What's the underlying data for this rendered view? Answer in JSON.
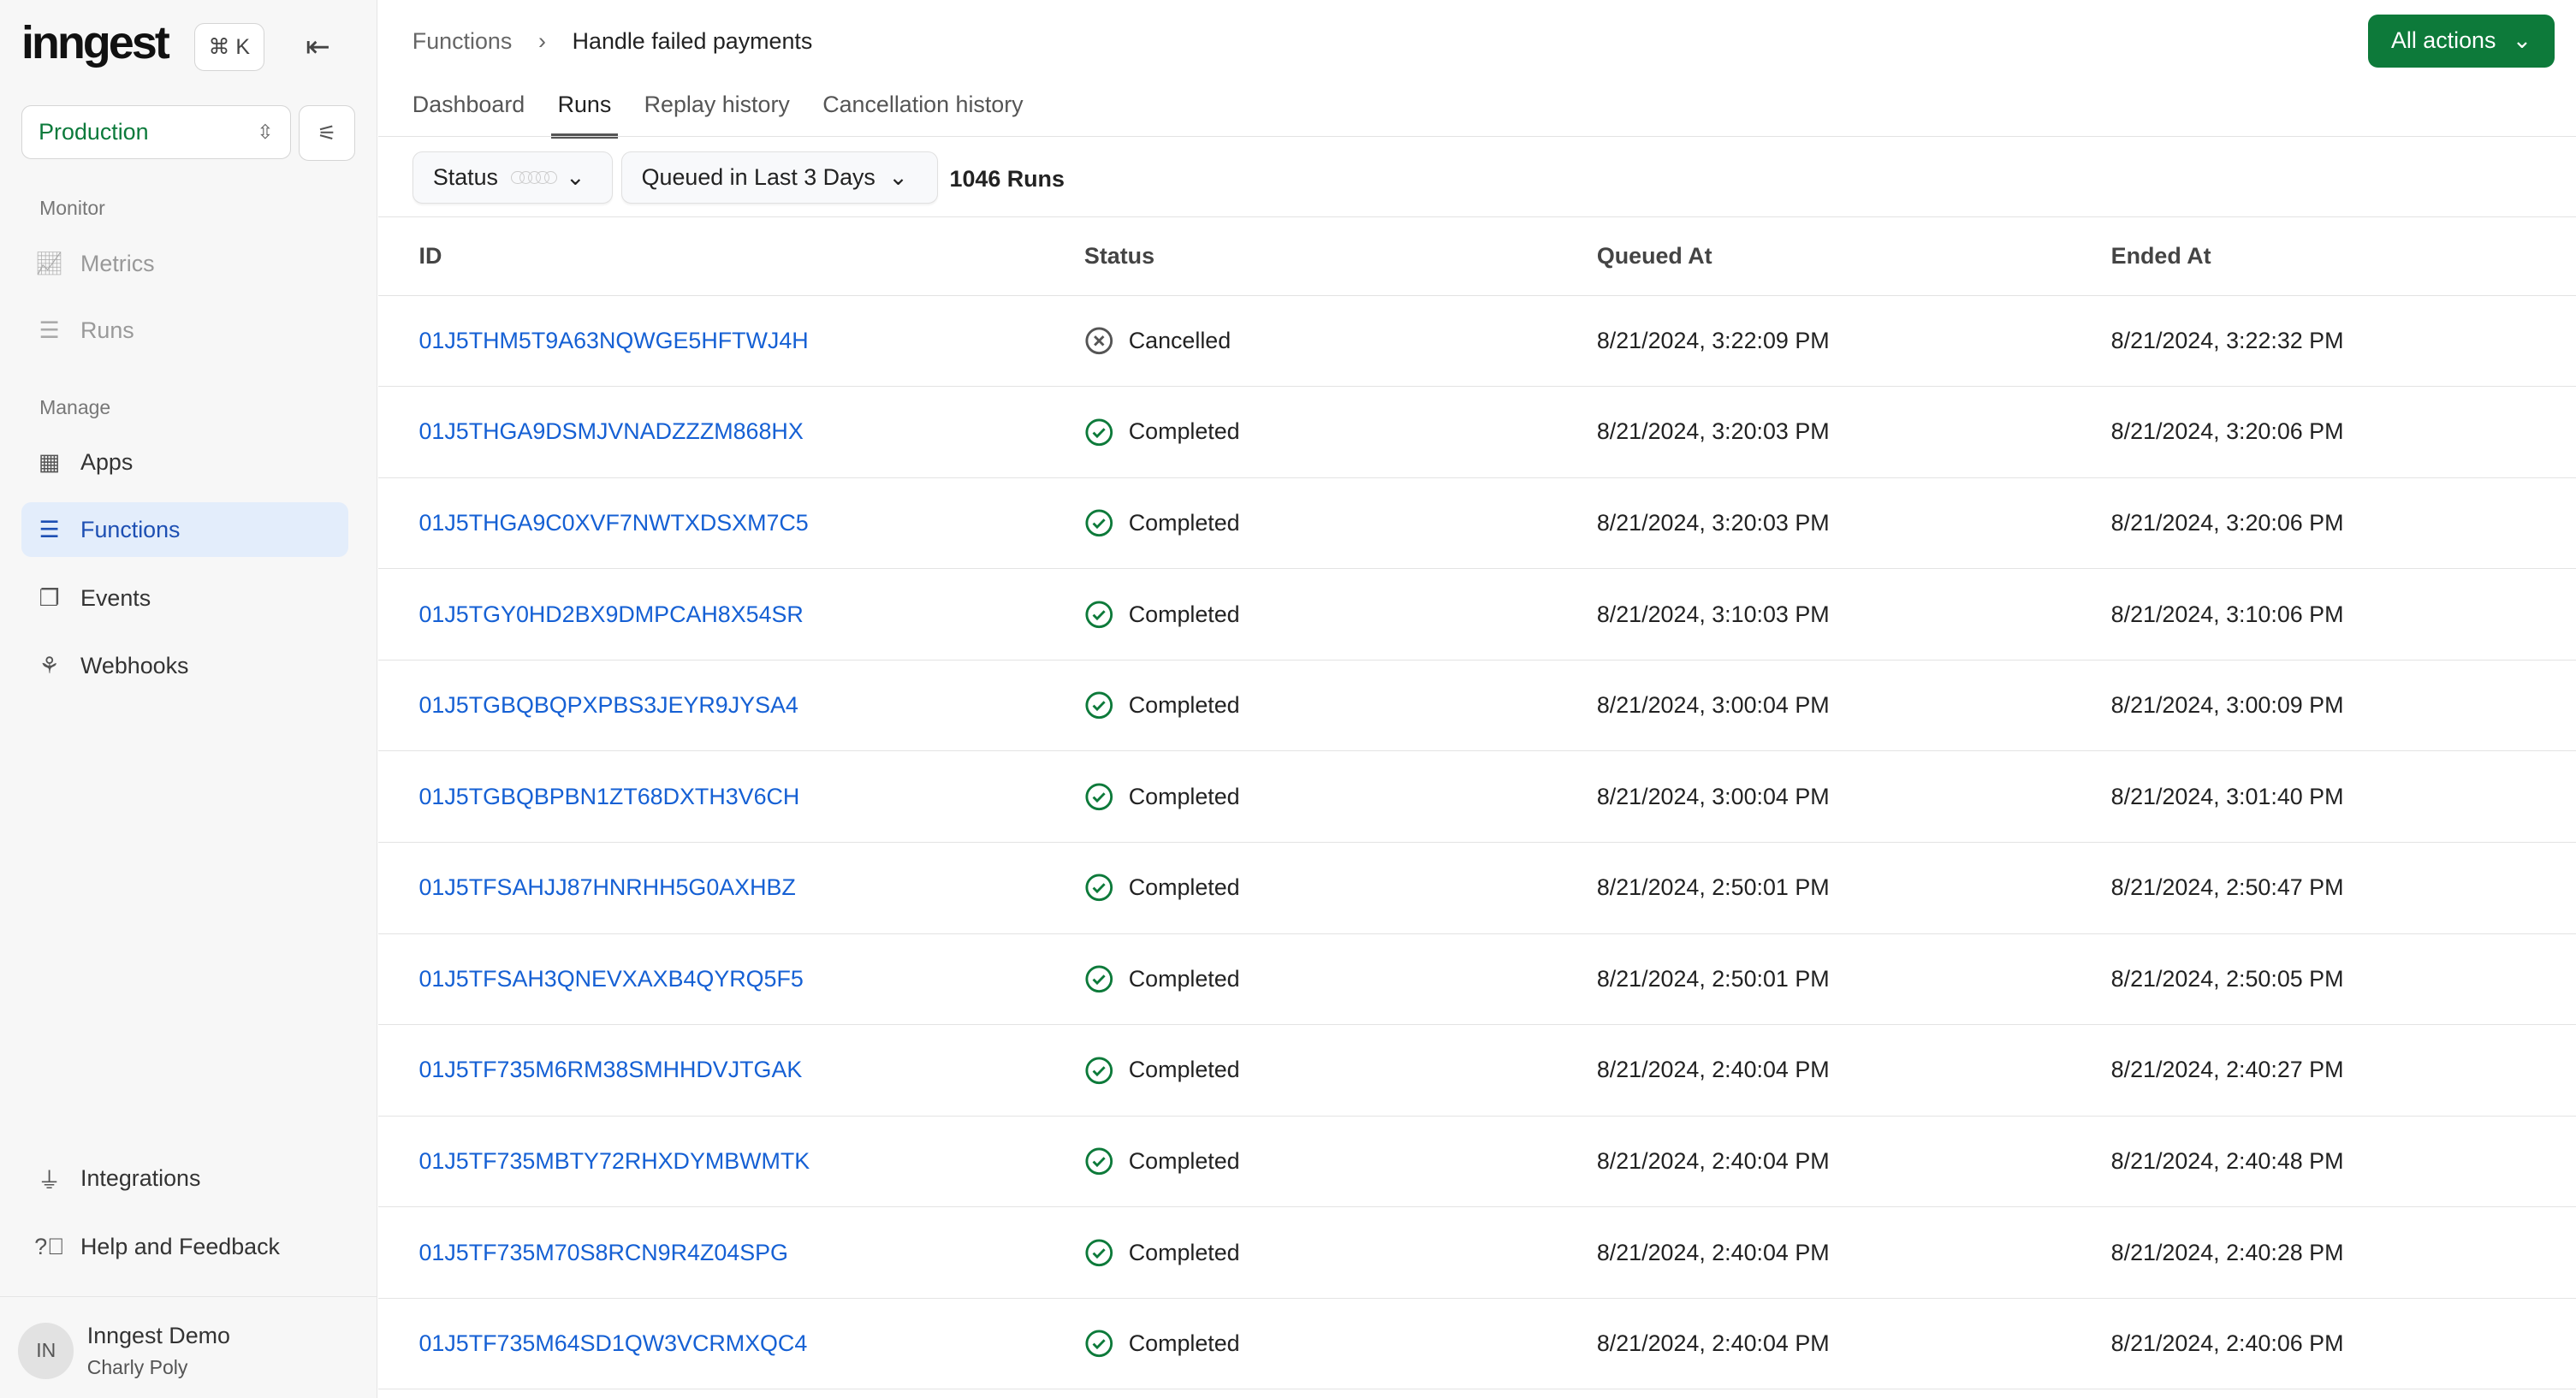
{
  "sidebar": {
    "logo": "inngest",
    "shortcut": "⌘ K",
    "environment": "Production",
    "sections": {
      "monitor": "Monitor",
      "manage": "Manage"
    },
    "items": [
      {
        "label": "Metrics"
      },
      {
        "label": "Runs"
      },
      {
        "label": "Apps"
      },
      {
        "label": "Functions"
      },
      {
        "label": "Events"
      },
      {
        "label": "Webhooks"
      },
      {
        "label": "Integrations"
      },
      {
        "label": "Help and Feedback"
      }
    ],
    "user": {
      "initials": "IN",
      "org": "Inngest Demo",
      "name": "Charly Poly"
    }
  },
  "header": {
    "breadcrumb": [
      "Functions",
      "Handle failed payments"
    ],
    "all_actions": "All actions"
  },
  "tabs": [
    {
      "label": "Dashboard"
    },
    {
      "label": "Runs"
    },
    {
      "label": "Replay history"
    },
    {
      "label": "Cancellation history"
    }
  ],
  "filters": {
    "status": "Status",
    "time": "Queued in Last 3 Days",
    "count": "1046 Runs"
  },
  "table": {
    "columns": [
      "ID",
      "Status",
      "Queued At",
      "Ended At"
    ],
    "rows": [
      {
        "id": "01J5THM5T9A63NQWGE5HFTWJ4H",
        "status": "Cancelled",
        "queued": "8/21/2024, 3:22:09 PM",
        "ended": "8/21/2024, 3:22:32 PM"
      },
      {
        "id": "01J5THGA9DSMJVNADZZZM868HX",
        "status": "Completed",
        "queued": "8/21/2024, 3:20:03 PM",
        "ended": "8/21/2024, 3:20:06 PM"
      },
      {
        "id": "01J5THGA9C0XVF7NWTXDSXM7C5",
        "status": "Completed",
        "queued": "8/21/2024, 3:20:03 PM",
        "ended": "8/21/2024, 3:20:06 PM"
      },
      {
        "id": "01J5TGY0HD2BX9DMPCAH8X54SR",
        "status": "Completed",
        "queued": "8/21/2024, 3:10:03 PM",
        "ended": "8/21/2024, 3:10:06 PM"
      },
      {
        "id": "01J5TGBQBQPXPBS3JEYR9JYSA4",
        "status": "Completed",
        "queued": "8/21/2024, 3:00:04 PM",
        "ended": "8/21/2024, 3:00:09 PM"
      },
      {
        "id": "01J5TGBQBPBN1ZT68DXTH3V6CH",
        "status": "Completed",
        "queued": "8/21/2024, 3:00:04 PM",
        "ended": "8/21/2024, 3:01:40 PM"
      },
      {
        "id": "01J5TFSAHJJ87HNRHH5G0AXHBZ",
        "status": "Completed",
        "queued": "8/21/2024, 2:50:01 PM",
        "ended": "8/21/2024, 2:50:47 PM"
      },
      {
        "id": "01J5TFSAH3QNEVXAXB4QYRQ5F5",
        "status": "Completed",
        "queued": "8/21/2024, 2:50:01 PM",
        "ended": "8/21/2024, 2:50:05 PM"
      },
      {
        "id": "01J5TF735M6RM38SMHHDVJTGAK",
        "status": "Completed",
        "queued": "8/21/2024, 2:40:04 PM",
        "ended": "8/21/2024, 2:40:27 PM"
      },
      {
        "id": "01J5TF735MBTY72RHXDYMBWMTK",
        "status": "Completed",
        "queued": "8/21/2024, 2:40:04 PM",
        "ended": "8/21/2024, 2:40:48 PM"
      },
      {
        "id": "01J5TF735M70S8RCN9R4Z04SPG",
        "status": "Completed",
        "queued": "8/21/2024, 2:40:04 PM",
        "ended": "8/21/2024, 2:40:28 PM"
      },
      {
        "id": "01J5TF735M64SD1QW3VCRMXQC4",
        "status": "Completed",
        "queued": "8/21/2024, 2:40:04 PM",
        "ended": "8/21/2024, 2:40:06 PM"
      }
    ]
  },
  "colors": {
    "accent": "#0d7a3a",
    "link": "#1560d4",
    "completed": "#0d7a3a",
    "cancelled": "#555555"
  }
}
